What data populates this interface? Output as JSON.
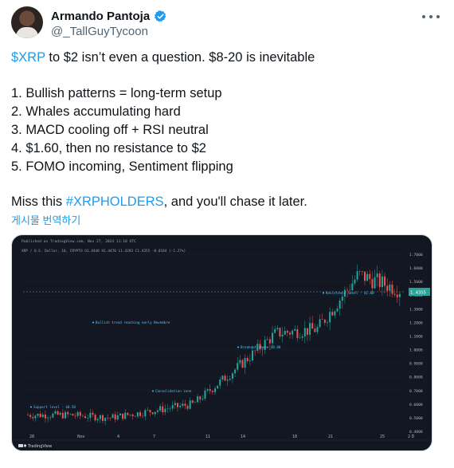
{
  "author": {
    "display_name": "Armando Pantoja",
    "handle": "@_TallGuyTycoon",
    "verified_icon": "verified-badge-icon",
    "avatar_icon": "avatar"
  },
  "tweet": {
    "line1_link": "$XRP",
    "line1_rest": " to $2 isn’t even a question. $8-20 is inevitable",
    "list": [
      "1. Bullish patterns = long-term setup",
      "2. Whales accumulating hard",
      "3. MACD cooling off + RSI neutral",
      "4. $1.60, then no resistance to $2",
      "5. FOMO incoming, Sentiment flipping"
    ],
    "closing_pre": "Miss this ",
    "closing_link": "#XRPHOLDERS",
    "closing_post": ", and you'll chase it later.",
    "translate_label": "게시물 번역하기"
  },
  "colors": {
    "link": "#1d9bf0",
    "chart_bg": "#131722",
    "candle_up": "#26a69a",
    "candle_down": "#ef5350",
    "annotation": "#4fc3f7"
  },
  "chart": {
    "header": "Published on TradingView.com, Nov 27, 2024 11:18 UTC",
    "symbol_line": "XRP / U.S. Dollar, 1D, CRYPTO  O1.4440  H1.4470  L1.4283  C1.4355  -0.0184 (-1.27%)",
    "y_labels": [
      "1.7000",
      "1.6000",
      "1.5000",
      "1.4000",
      "1.3000",
      "1.2000",
      "1.1000",
      "1.0000",
      "0.9000",
      "0.8000",
      "0.7000",
      "0.6000",
      "0.5000",
      "0.4000"
    ],
    "x_labels": [
      "28",
      "Nov",
      "4",
      "7",
      "11",
      "14",
      "18",
      "21",
      "25",
      "2 D"
    ],
    "price_tag": "1.4355",
    "annotations": [
      "Bullish trend reaching early Novembre",
      "Support level - $0.50",
      "Consolidation zone",
      "Breakout above $0.80",
      "Resistance level - $1.60"
    ],
    "watermark": "TradingView"
  },
  "chart_data": {
    "type": "line",
    "title": "",
    "xlabel": "",
    "ylabel": "",
    "ylim": [
      0.4,
      1.7
    ],
    "x": [
      "28",
      "Nov",
      "4",
      "7",
      "11",
      "14",
      "18",
      "21",
      "25",
      "2 D"
    ],
    "series": [
      {
        "values": [
          0.52,
          0.52,
          0.5,
          0.55,
          0.6,
          0.85,
          1.12,
          1.15,
          1.55,
          1.44
        ]
      }
    ]
  }
}
